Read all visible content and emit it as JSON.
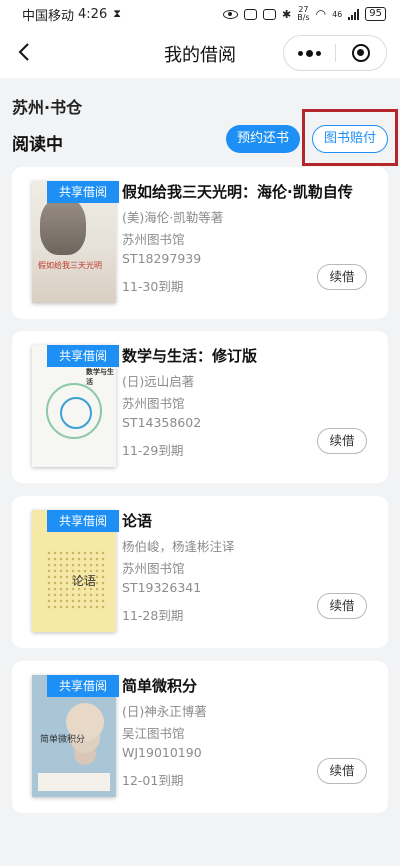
{
  "status_bar": {
    "carrier": "中国移动",
    "time": "4:26",
    "net_speed_value": "27",
    "net_speed_unit": "B/s",
    "net_type": "46",
    "battery": "95"
  },
  "nav": {
    "title": "我的借阅"
  },
  "library": {
    "name": "苏州·书仓"
  },
  "section": {
    "title": "阅读中",
    "reserve_button": "预约还书",
    "compensate_button": "图书赔付"
  },
  "books": [
    {
      "badge": "共享借阅",
      "title": "假如给我三天光明：海伦·凯勒自传",
      "author": "(美)海伦·凯勒等著",
      "library": "苏州图书馆",
      "id": "ST18297939",
      "due": "11-30到期",
      "renew_label": "续借",
      "cover_text": "假如给我三天光明"
    },
    {
      "badge": "共享借阅",
      "title": "数学与生活：修订版",
      "author": "(日)远山启著",
      "library": "苏州图书馆",
      "id": "ST14358602",
      "due": "11-29到期",
      "renew_label": "续借",
      "cover_text": "数学与生活"
    },
    {
      "badge": "共享借阅",
      "title": "论语",
      "author": "杨伯峻，杨逢彬注译",
      "library": "苏州图书馆",
      "id": "ST19326341",
      "due": "11-28到期",
      "renew_label": "续借",
      "cover_text": "论语"
    },
    {
      "badge": "共享借阅",
      "title": "简单微积分",
      "author": "(日)神永正博著",
      "library": "吴江图书馆",
      "id": "WJ19010190",
      "due": "12-01到期",
      "renew_label": "续借",
      "cover_text": "简单微积分"
    }
  ],
  "colors": {
    "accent": "#1e90f5",
    "highlight": "#b3262c",
    "page_bg": "#f2f3f5"
  }
}
